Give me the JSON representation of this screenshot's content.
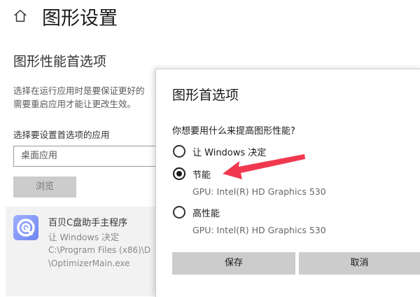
{
  "page": {
    "title": "图形设置",
    "home_icon": "home-icon"
  },
  "section": {
    "title": "图形性能首选项",
    "description_lines": [
      "选择在运行应用时是要保证更好的",
      "需要重启应用才能让更改生效。"
    ],
    "choose_label": "选择要设置首选项的应用",
    "app_type_value": "桌面应用",
    "browse_label": "浏览"
  },
  "app_item": {
    "name": "百贝C盘助手主程序",
    "preference": "让 Windows 决定",
    "path_lines": [
      "C:\\Program Files (x86)\\D",
      "\\OptimizerMain.exe"
    ]
  },
  "dialog": {
    "title": "图形首选项",
    "question": "你想要用什么来提高图形性能?",
    "options": [
      {
        "label": "让 Windows 决定",
        "checked": false,
        "gpu": ""
      },
      {
        "label": "节能",
        "checked": true,
        "gpu": "GPU: Intel(R) HD Graphics 530"
      },
      {
        "label": "高性能",
        "checked": false,
        "gpu": "GPU: Intel(R) HD Graphics 530"
      }
    ],
    "save_label": "保存",
    "cancel_label": "取消"
  },
  "colors": {
    "annotation_arrow": "#f0384f",
    "button_bg": "#cccccc"
  }
}
